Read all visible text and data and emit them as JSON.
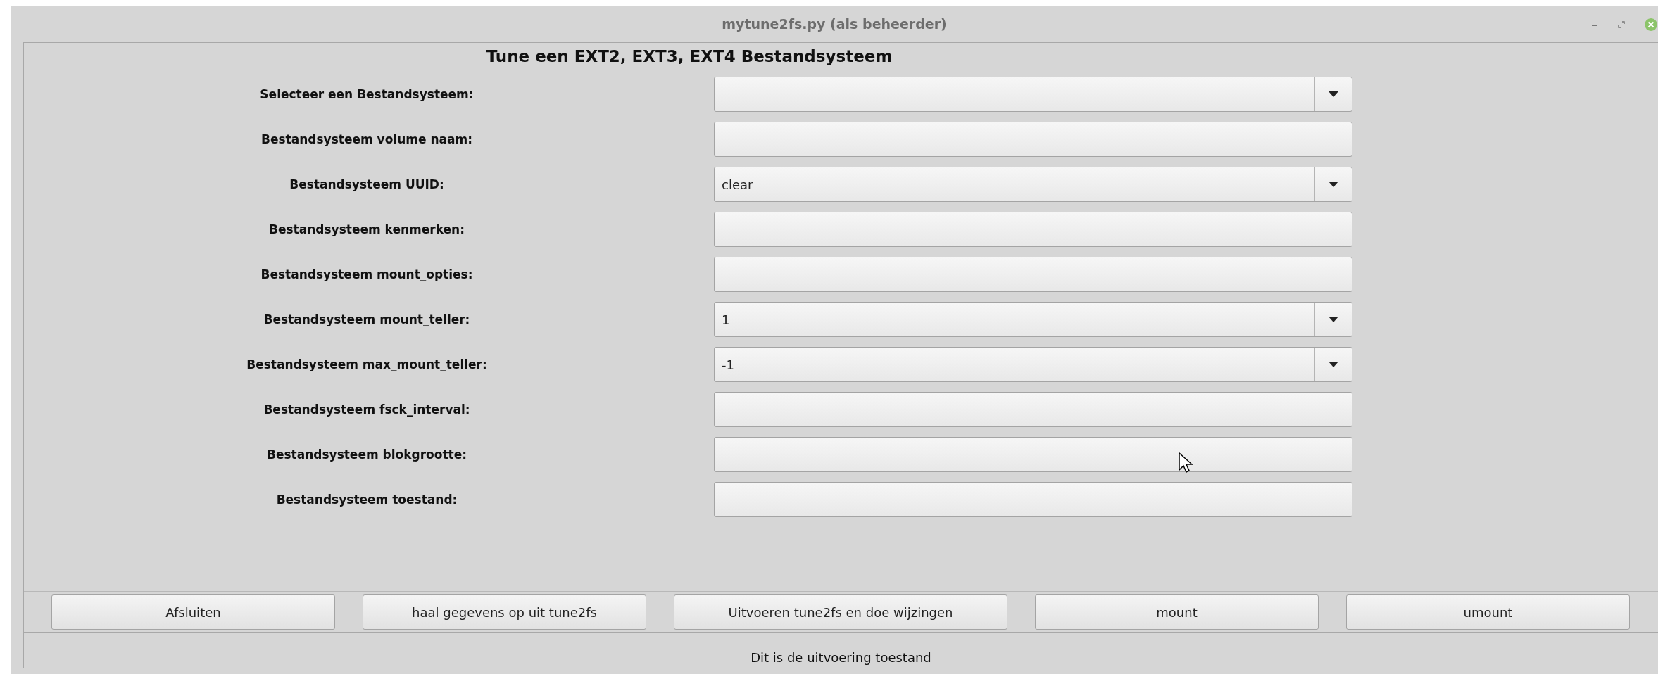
{
  "window": {
    "title": "mytune2fs.py (als beheerder)"
  },
  "heading": "Tune een EXT2, EXT3, EXT4 Bestandsysteem",
  "fields": [
    {
      "label": "Selecteer een Bestandsysteem:",
      "kind": "combo"
    },
    {
      "label": "Bestandsysteem volume naam:",
      "kind": "entry"
    },
    {
      "label": "Bestandsysteem UUID:",
      "kind": "combo",
      "value": "clear"
    },
    {
      "label": "Bestandsysteem kenmerken:",
      "kind": "entry"
    },
    {
      "label": "Bestandsysteem mount_opties:",
      "kind": "entry"
    },
    {
      "label": "Bestandsysteem mount_teller:",
      "kind": "combo",
      "value": "1"
    },
    {
      "label": "Bestandsysteem max_mount_teller:",
      "kind": "combo",
      "value": "-1"
    },
    {
      "label": "Bestandsysteem fsck_interval:",
      "kind": "entry"
    },
    {
      "label": "Bestandsysteem blokgrootte:",
      "kind": "entry"
    },
    {
      "label": "Bestandsysteem toestand:",
      "kind": "entry"
    }
  ],
  "buttons": [
    "Afsluiten",
    "haal gegevens op uit tune2fs",
    "Uitvoeren tune2fs en doe wijzingen",
    "mount",
    "umount"
  ],
  "status_bar": "Dit is de uitvoering toestand"
}
